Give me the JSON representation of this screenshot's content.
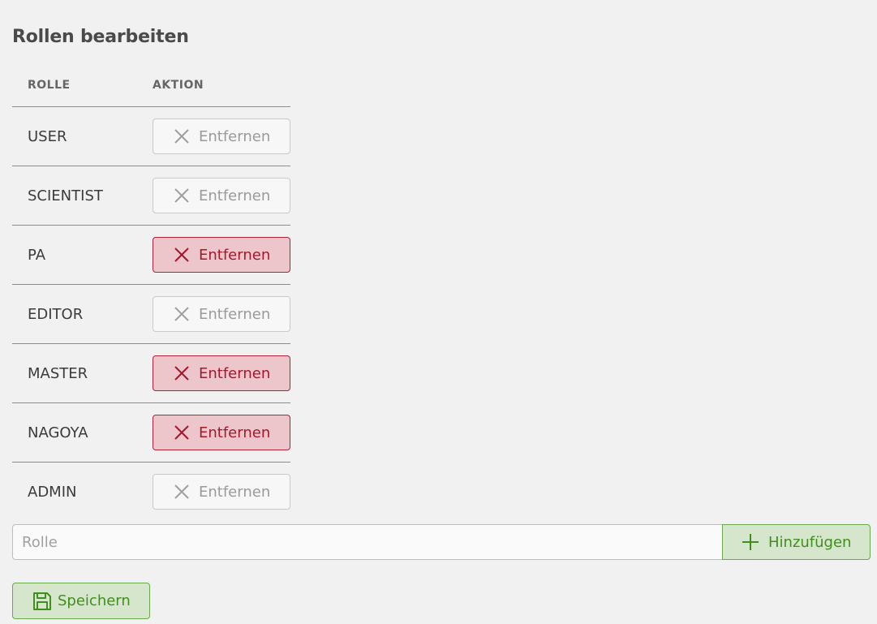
{
  "page": {
    "title": "Rollen bearbeiten"
  },
  "table": {
    "headers": {
      "role": "ROLLE",
      "action": "AKTION"
    },
    "rows": [
      {
        "role": "USER",
        "action_label": "Entfernen",
        "active": false
      },
      {
        "role": "SCIENTIST",
        "action_label": "Entfernen",
        "active": false
      },
      {
        "role": "PA",
        "action_label": "Entfernen",
        "active": true
      },
      {
        "role": "EDITOR",
        "action_label": "Entfernen",
        "active": false
      },
      {
        "role": "MASTER",
        "action_label": "Entfernen",
        "active": true
      },
      {
        "role": "NAGOYA",
        "action_label": "Entfernen",
        "active": true
      },
      {
        "role": "ADMIN",
        "action_label": "Entfernen",
        "active": false
      }
    ]
  },
  "add_role": {
    "input_value": "",
    "placeholder": "Rolle",
    "button_label": "Hinzufügen",
    "icon": "plus-icon"
  },
  "save": {
    "button_label": "Speichern",
    "icon": "floppy-disk-icon"
  },
  "colors": {
    "danger": "#a3182c",
    "danger_bg": "#ecc6cb",
    "success": "#3f8f1c",
    "success_bg": "#d6e6cc",
    "disabled": "#9a9a9a"
  }
}
